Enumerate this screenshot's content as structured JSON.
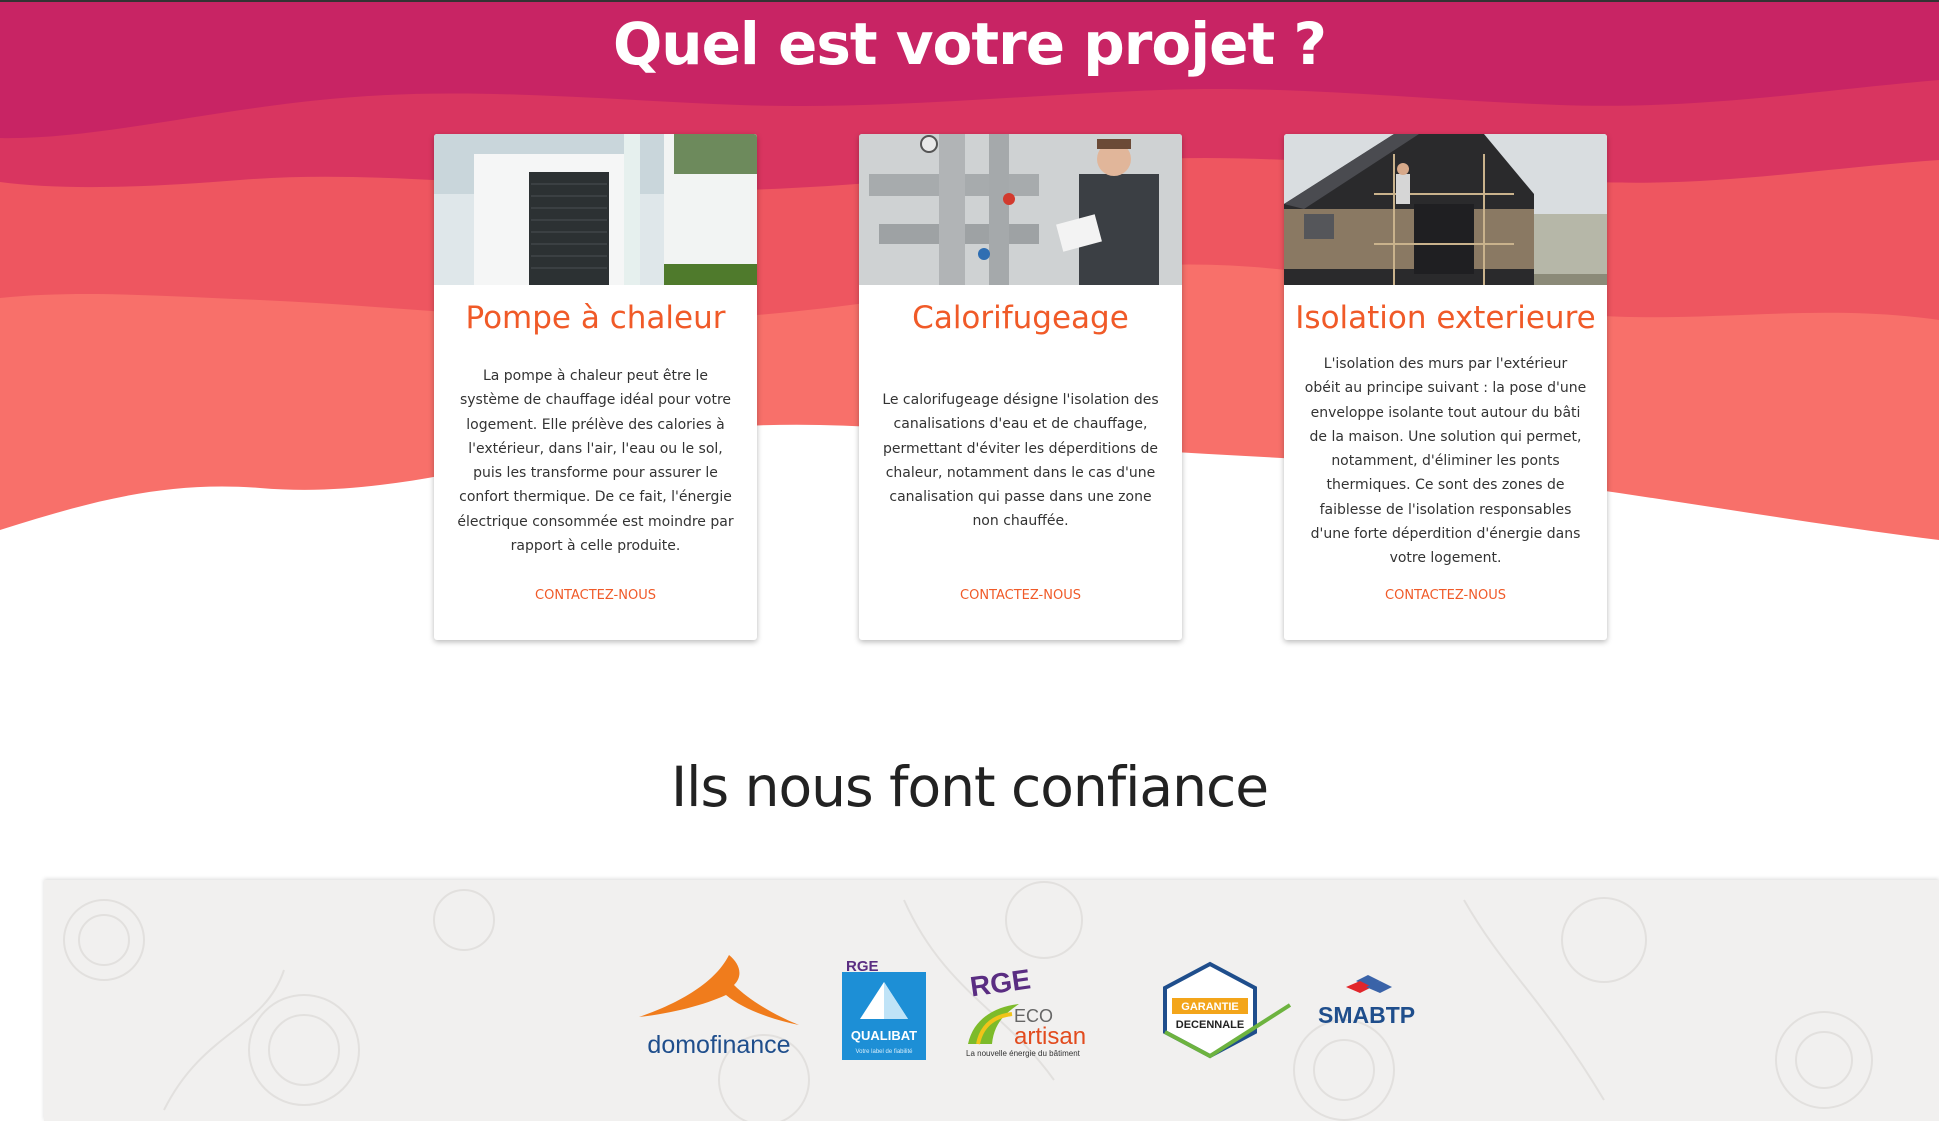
{
  "header": {
    "title": "Quel est votre projet ?"
  },
  "colors": {
    "hero_top": "#c82464",
    "hero_mid": "#e83d5a",
    "hero_low": "#f8706a",
    "accent": "#f05a28"
  },
  "cards": [
    {
      "title": "Pompe à chaleur",
      "text": "La pompe à chaleur peut être le système de chauffage idéal pour votre logement. Elle prélève des calories à l'extérieur, dans l'air, l'eau ou le sol, puis les transforme pour assurer le confort thermique. De ce fait, l'énergie électrique consommée est moindre par rapport à celle produite.",
      "link": "CONTACTEZ-NOUS"
    },
    {
      "title": "Calorifugeage",
      "text": "Le calorifugeage désigne l'isolation des canalisations d'eau et de chauffage, permettant d'éviter les déperditions de chaleur, notamment dans le cas d'une canalisation qui passe dans une zone non chauffée.",
      "link": "CONTACTEZ-NOUS"
    },
    {
      "title": "Isolation exterieure",
      "text": "L'isolation des murs par l'extérieur obéit au principe suivant : la pose d'une enveloppe isolante tout autour du bâti de la maison. Une solution qui permet, notamment, d'éliminer les ponts thermiques. Ce sont des zones de faiblesse de l'isolation responsables d'une forte déperdition d'énergie dans votre logement.",
      "link": "CONTACTEZ-NOUS"
    }
  ],
  "partners_section": {
    "title": "Ils nous font confiance"
  },
  "partners": {
    "domofinance": "domofinance",
    "qualibat_rge": "RGE",
    "qualibat": "QUALIBAT",
    "qualibat_tag": "Votre label de fiabilité",
    "eco_rge": "RGE",
    "eco": "ECO",
    "artisan": "artisan",
    "eco_tag": "La nouvelle énergie du bâtiment",
    "garantie_1": "GARANTIE",
    "garantie_2": "DECENNALE",
    "smabtp": "SMABTP"
  }
}
